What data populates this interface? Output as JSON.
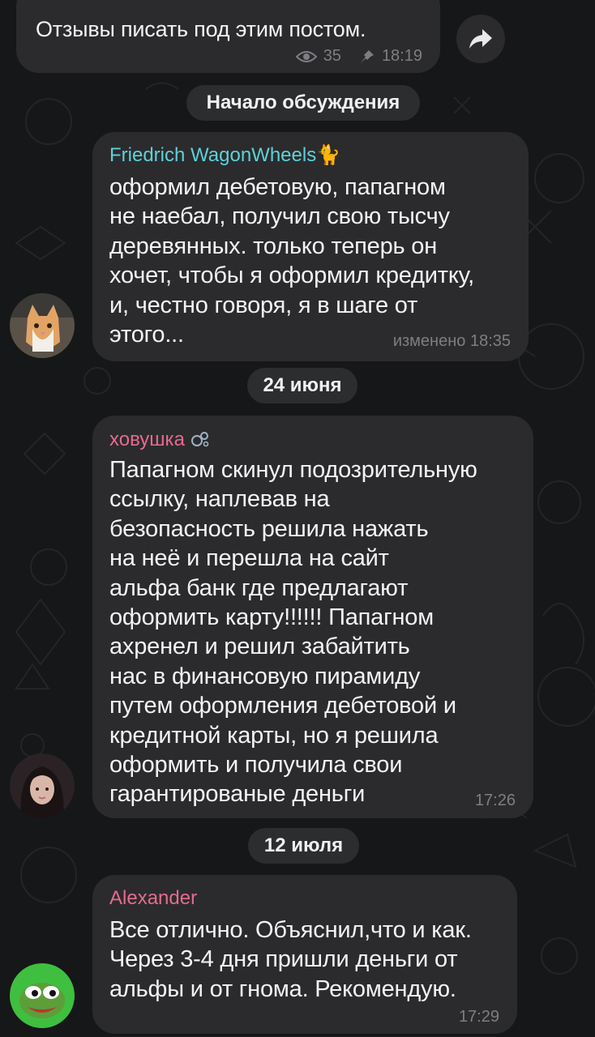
{
  "channel_post": {
    "text": "Отзывы писать под этим постом.",
    "views": "35",
    "time": "18:19",
    "views_icon": "eye-icon",
    "pin_icon": "pin-icon",
    "share_icon": "share-arrow-icon"
  },
  "separators": {
    "discussion_start": "Начало обсуждения",
    "date1": "24 июня",
    "date2": "12 июля"
  },
  "messages": [
    {
      "sender": "Friedrich WagonWheels",
      "sender_emoji": "🐈",
      "sender_color": "#5fd0d8",
      "text": "оформил дебетовую, папагном\nне наебал, получил свою тысчу\nдеревянных. только теперь он\nхочет, чтобы я оформил кредитку,\nи, честно говоря, я в шаге от\nэтого...",
      "meta": "изменено 18:35",
      "avatar": "cat-avatar"
    },
    {
      "sender": "ховушка",
      "sender_emoji": "🫧",
      "sender_color": "#e56b8f",
      "text": "Папагном скинул подозрительную\nссылку, наплевав на\nбезопасность решила нажать\nна неё и перешла на сайт\nальфа банк где предлагают\nоформить карту!!!!!! Папагном\nахренел и решил забайтить\nнас в финансовую пирамиду\nпутем оформления дебетовой и\nкредитной карты, но я решила\nоформить и получила свои\nгарантированые деньги",
      "meta": "17:26",
      "avatar": "girl-avatar"
    },
    {
      "sender": "Alexander",
      "sender_emoji": "",
      "sender_color": "#e56b8f",
      "text": "Все отлично. Объяснил,что и как.\nЧерез 3-4 дня пришли деньги от\nальфы и от гнома. Рекомендую.",
      "meta": "17:29",
      "avatar": "pepe-frog-avatar"
    }
  ]
}
